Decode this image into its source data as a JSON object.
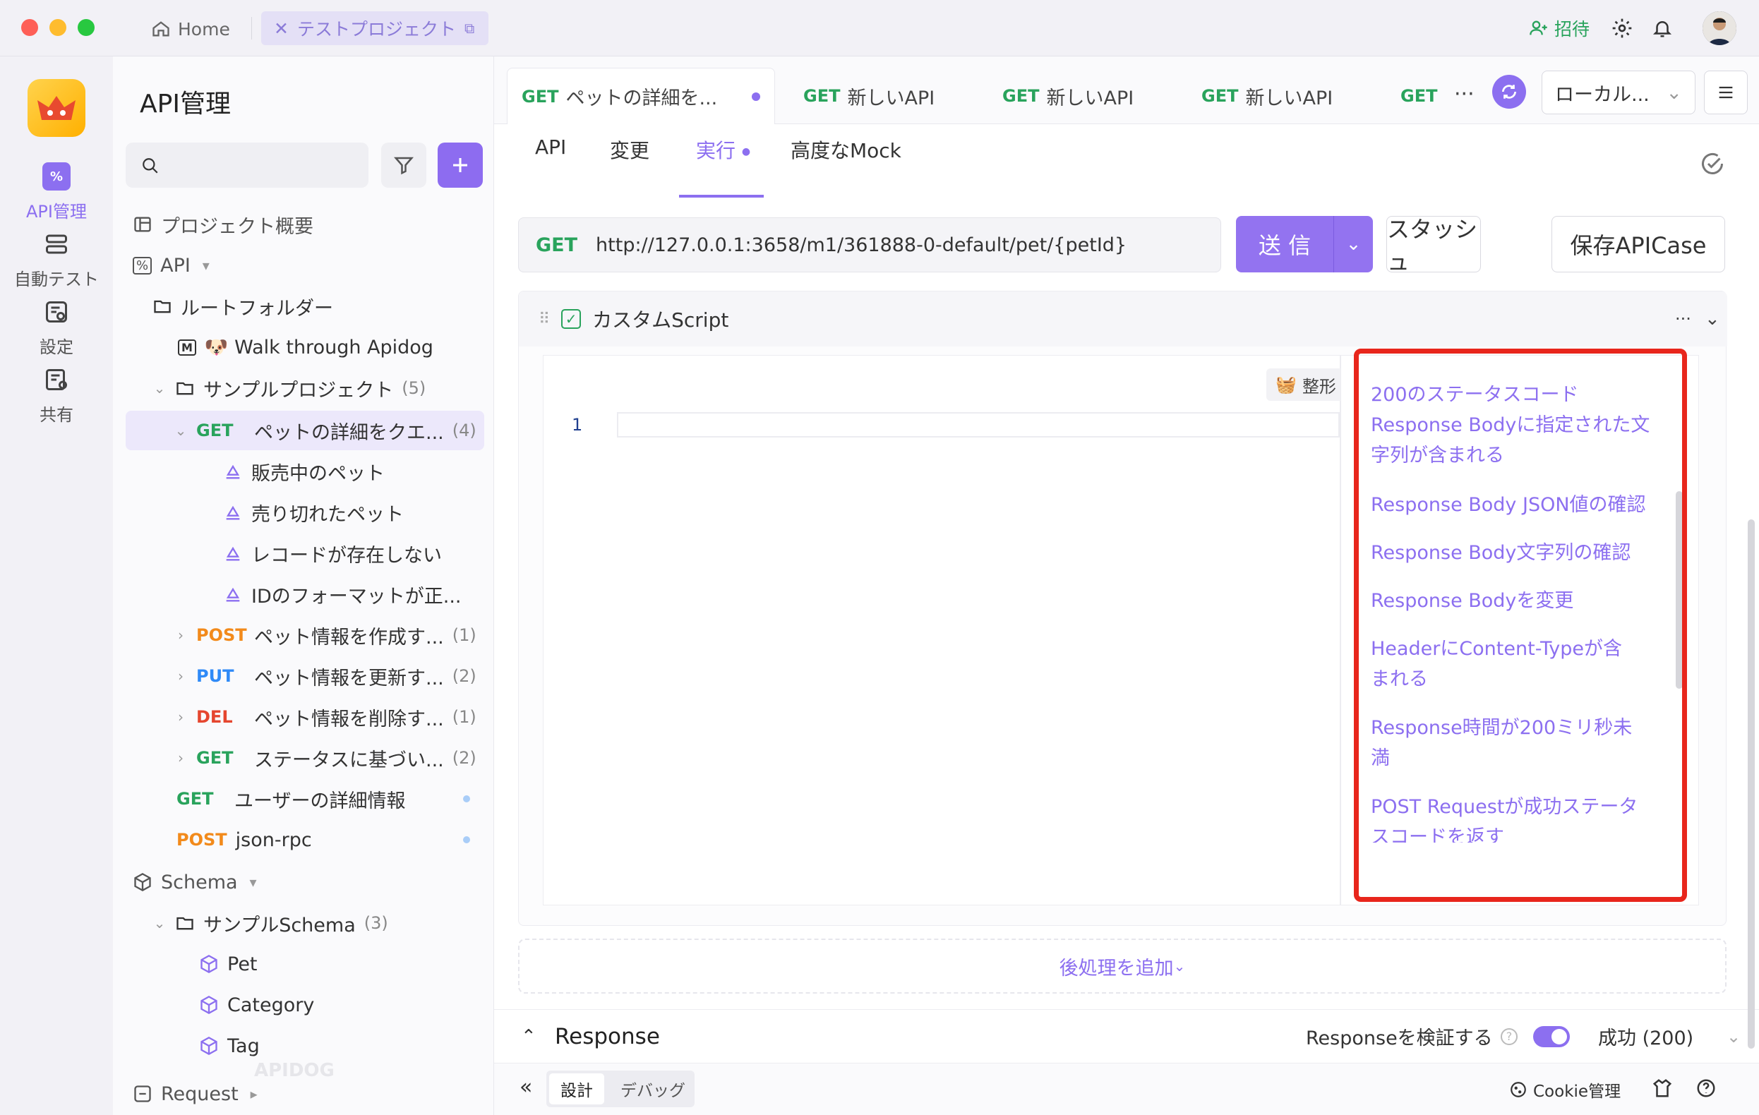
{
  "topbar": {
    "home_label": "Home",
    "project_tab": "テストプロジェクト",
    "invite_label": "招待"
  },
  "rail": {
    "items": [
      {
        "label": "API管理",
        "icon": "api-icon",
        "active": true
      },
      {
        "label": "自動テスト",
        "icon": "auto-test-icon"
      },
      {
        "label": "設定",
        "icon": "settings-icon"
      },
      {
        "label": "共有",
        "icon": "share-icon"
      }
    ]
  },
  "sidebar": {
    "title": "API管理",
    "search_placeholder": "",
    "overview": "プロジェクト概要",
    "api_root": "API",
    "root_folder": "ルートフォルダー",
    "walk": "🐶 Walk through Apidog",
    "sample_project": "サンプルプロジェクト",
    "sample_project_count": "(5)",
    "endpoints": [
      {
        "method": "GET",
        "name": "ペットの詳細をクエ...",
        "count": "(4)"
      },
      {
        "method": "POST",
        "name": "ペット情報を作成す...",
        "count": "(1)"
      },
      {
        "method": "PUT",
        "name": "ペット情報を更新す...",
        "count": "(2)"
      },
      {
        "method": "DEL",
        "name": "ペット情報を削除す...",
        "count": "(1)"
      },
      {
        "method": "GET",
        "name": "ステータスに基づい...",
        "count": "(2)"
      },
      {
        "method": "GET",
        "name": "ユーザーの詳細情報",
        "count": ""
      },
      {
        "method": "POST",
        "name": "json-rpc",
        "count": ""
      }
    ],
    "cases": [
      "販売中のペット",
      "売り切れたペット",
      "レコードが存在しない",
      "IDのフォーマットが正..."
    ],
    "schema_root": "Schema",
    "sample_schema": "サンプルSchema",
    "sample_schema_count": "(3)",
    "schemas": [
      "Pet",
      "Category",
      "Tag"
    ],
    "request_root": "Request",
    "watermark": "APIDOG"
  },
  "tabs": [
    {
      "method": "GET",
      "label": "ペットの詳細を..."
    },
    {
      "method": "GET",
      "label": "新しいAPI"
    },
    {
      "method": "GET",
      "label": "新しいAPI"
    },
    {
      "method": "GET",
      "label": "新しいAPI"
    },
    {
      "method": "GET",
      "label": ""
    }
  ],
  "env_select": "ローカル...",
  "subtabs": {
    "api": "API",
    "change": "変更",
    "run": "実行",
    "mock": "高度なMock"
  },
  "request": {
    "method": "GET",
    "url": "http://127.0.0.1:3658/m1/361888-0-default/pet/{petId}",
    "send": "送 信",
    "stash": "スタッシュ",
    "save": "保存APICase"
  },
  "script": {
    "title": "カスタムScript",
    "format": "整形",
    "line_no": "1",
    "snippets": [
      "200のステータスコード",
      "Response Bodyに指定された文字列が含まれる",
      "Response Body JSON値の確認",
      "Response Body文字列の確認",
      "Response Bodyを変更",
      "HeaderにContent-Typeが含まれる",
      "Response時間が200ミリ秒未満",
      "POST Requestが成功ステータスコードを返す"
    ]
  },
  "add_post": "後処理を追加",
  "response": {
    "title": "Response",
    "validate": "Responseを検証する",
    "status": "成功 (200)"
  },
  "bottom": {
    "design": "設計",
    "debug": "デバッグ",
    "cookie": "Cookie管理"
  },
  "colors": {
    "accent": "#8c6ff0",
    "get": "#29a35c",
    "post": "#f28a1b",
    "put": "#2f8af7",
    "del": "#e5462f",
    "highlight": "#e8261c"
  }
}
